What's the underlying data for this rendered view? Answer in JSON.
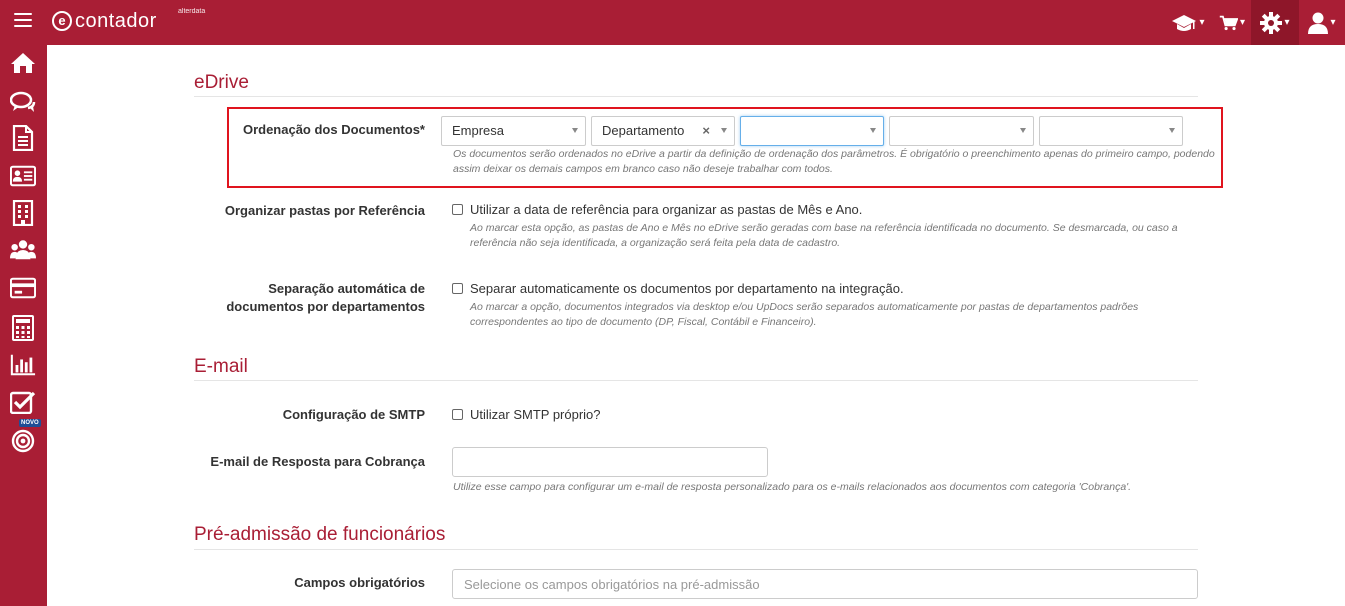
{
  "app": {
    "logo_letter": "e",
    "logo_text": "contador",
    "logo_brand": "alterdata"
  },
  "topbar": {
    "caret": "▾"
  },
  "sidebar": {
    "novo_badge": "NOVO"
  },
  "edrive": {
    "title": "eDrive",
    "ordenacao": {
      "label": "Ordenação dos Documentos*",
      "select1": "Empresa",
      "select2": "Departamento",
      "clear": "×",
      "help": "Os documentos serão ordenados no eDrive a partir da definição de ordenação dos parâmetros. É obrigatório o preenchimento apenas do primeiro campo, podendo assim deixar os demais campos em branco caso não deseje trabalhar com todos."
    },
    "pastas": {
      "label": "Organizar pastas por Referência",
      "checkbox": "Utilizar a data de referência para organizar as pastas de Mês e Ano.",
      "help": "Ao marcar esta opção, as pastas de Ano e Mês no eDrive serão geradas com base na referência identificada no documento. Se desmarcada, ou caso a referência não seja identificada, a organização será feita pela data de cadastro."
    },
    "separacao": {
      "label": "Separação automática de documentos por departamentos",
      "checkbox": "Separar automaticamente os documentos por departamento na integração.",
      "help": "Ao marcar a opção, documentos integrados via desktop e/ou UpDocs serão separados automaticamente por pastas de departamentos padrões correspondentes ao tipo de documento (DP, Fiscal, Contábil e Financeiro)."
    }
  },
  "email": {
    "title": "E-mail",
    "smtp": {
      "label": "Configuração de SMTP",
      "checkbox": "Utilizar SMTP próprio?"
    },
    "resposta": {
      "label": "E-mail de Resposta para Cobrança",
      "value": "",
      "help": "Utilize esse campo para configurar um e-mail de resposta personalizado para os e-mails relacionados aos documentos com categoria 'Cobrança'."
    }
  },
  "preadmissao": {
    "title": "Pré-admissão de funcionários",
    "campos": {
      "label": "Campos obrigatórios",
      "placeholder": "Selecione os campos obrigatórios na pré-admissão"
    }
  },
  "colors": {
    "brand": "#a91e35",
    "brand_dark": "#8e1629",
    "highlight_border": "#e0141e",
    "badge": "#1f4e96"
  }
}
